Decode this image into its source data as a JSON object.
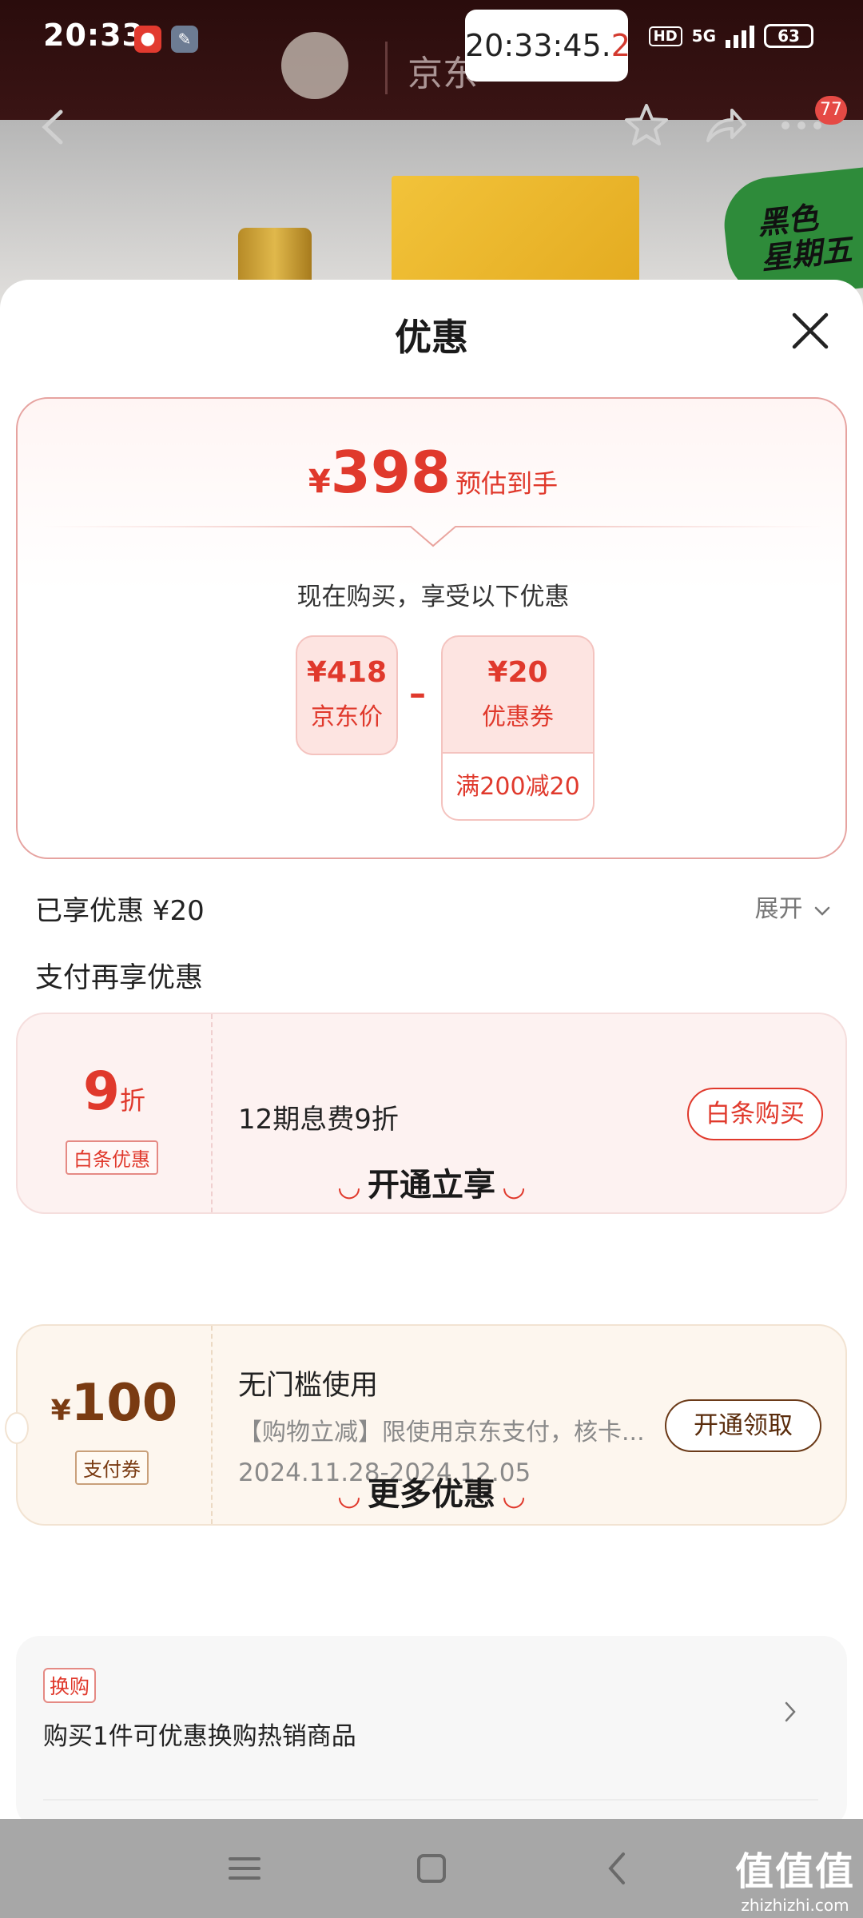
{
  "status_bar": {
    "time": "20:33",
    "clock_chip_main": "20:33:45.",
    "clock_chip_tenth": "2",
    "network": "5G",
    "hd": "HD",
    "battery": "63"
  },
  "header": {
    "brand_text": "京东",
    "more_badge": "77",
    "promo_text_line1": "黑色",
    "promo_text_line2": "星期五"
  },
  "sheet": {
    "title": "优惠",
    "summary": {
      "currency": "¥",
      "final_price": "398",
      "final_label": "预估到手",
      "buy_now_text": "现在购买，享受以下优惠",
      "jd_price_value": "¥418",
      "jd_price_label": "京东价",
      "minus": "–",
      "coupon_value": "¥20",
      "coupon_label": "优惠券",
      "coupon_condition": "满200减20"
    },
    "enjoyed_text": "已享优惠 ¥20",
    "expand_label": "展开",
    "pay_more_title": "支付再享优惠",
    "baitiao": {
      "rate": "9",
      "rate_unit": "折",
      "tag": "白条优惠",
      "desc": "12期息费9折",
      "button": "白条购买"
    },
    "open_section_title": "开通立享",
    "pay_coupon": {
      "currency": "¥",
      "amount": "100",
      "tag": "支付券",
      "title": "无门槛使用",
      "subtitle": "【购物立减】限使用京东支付，核卡...",
      "date_range": "2024.11.28-2024.12.05",
      "button": "开通领取"
    },
    "more_section_title": "更多优惠",
    "more": {
      "tag": "换购",
      "desc": "购买1件可优惠换购热销商品"
    }
  },
  "watermark": {
    "big": "值值值",
    "small": "zhizhizhi.com"
  },
  "colors": {
    "accent": "#e0392c",
    "pay_brown": "#7a3b12"
  }
}
